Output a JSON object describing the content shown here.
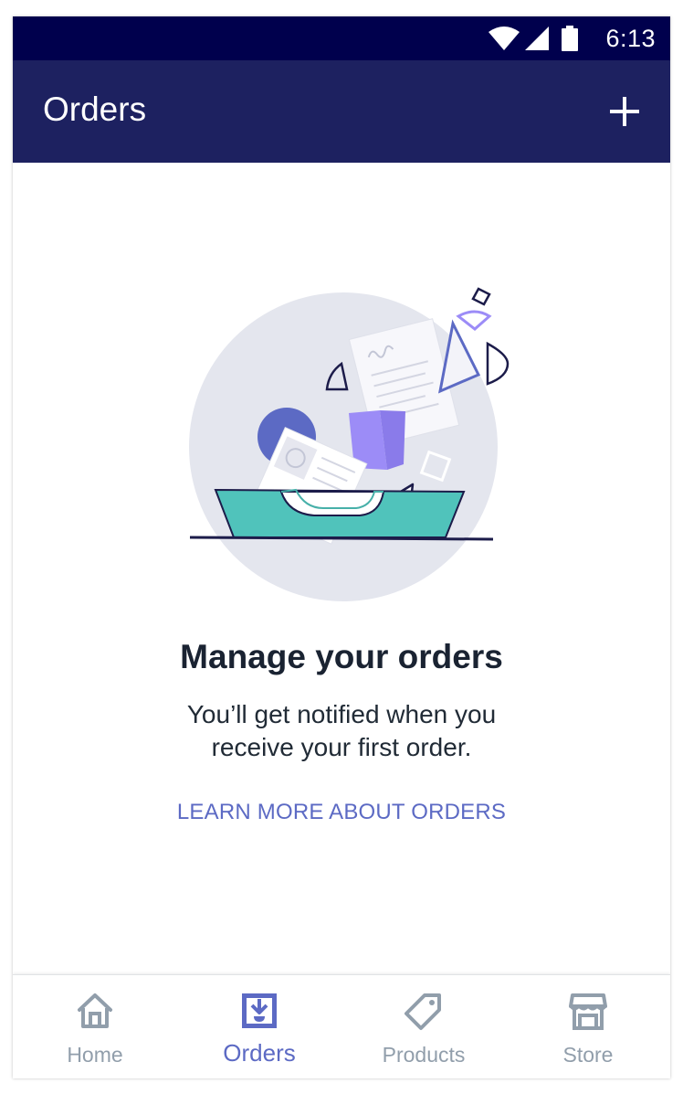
{
  "status_bar": {
    "time": "6:13"
  },
  "app_bar": {
    "title": "Orders",
    "action_icon": "plus-icon"
  },
  "empty_state": {
    "illustration": "orders-inbox-illustration",
    "title": "Manage your orders",
    "body": "You’ll get notified when you receive your first order.",
    "link": "LEARN MORE ABOUT ORDERS"
  },
  "bottom_nav": {
    "items": [
      {
        "label": "Home",
        "icon": "home-icon",
        "active": false
      },
      {
        "label": "Orders",
        "icon": "orders-inbox-icon",
        "active": true
      },
      {
        "label": "Products",
        "icon": "tag-icon",
        "active": false
      },
      {
        "label": "Store",
        "icon": "store-icon",
        "active": false
      }
    ]
  },
  "colors": {
    "status_bar": "#00004d",
    "app_bar": "#1d2160",
    "accent": "#5c6ac4",
    "inactive": "#919eab",
    "heading": "#1a2332",
    "tray": "#50c3bb"
  }
}
